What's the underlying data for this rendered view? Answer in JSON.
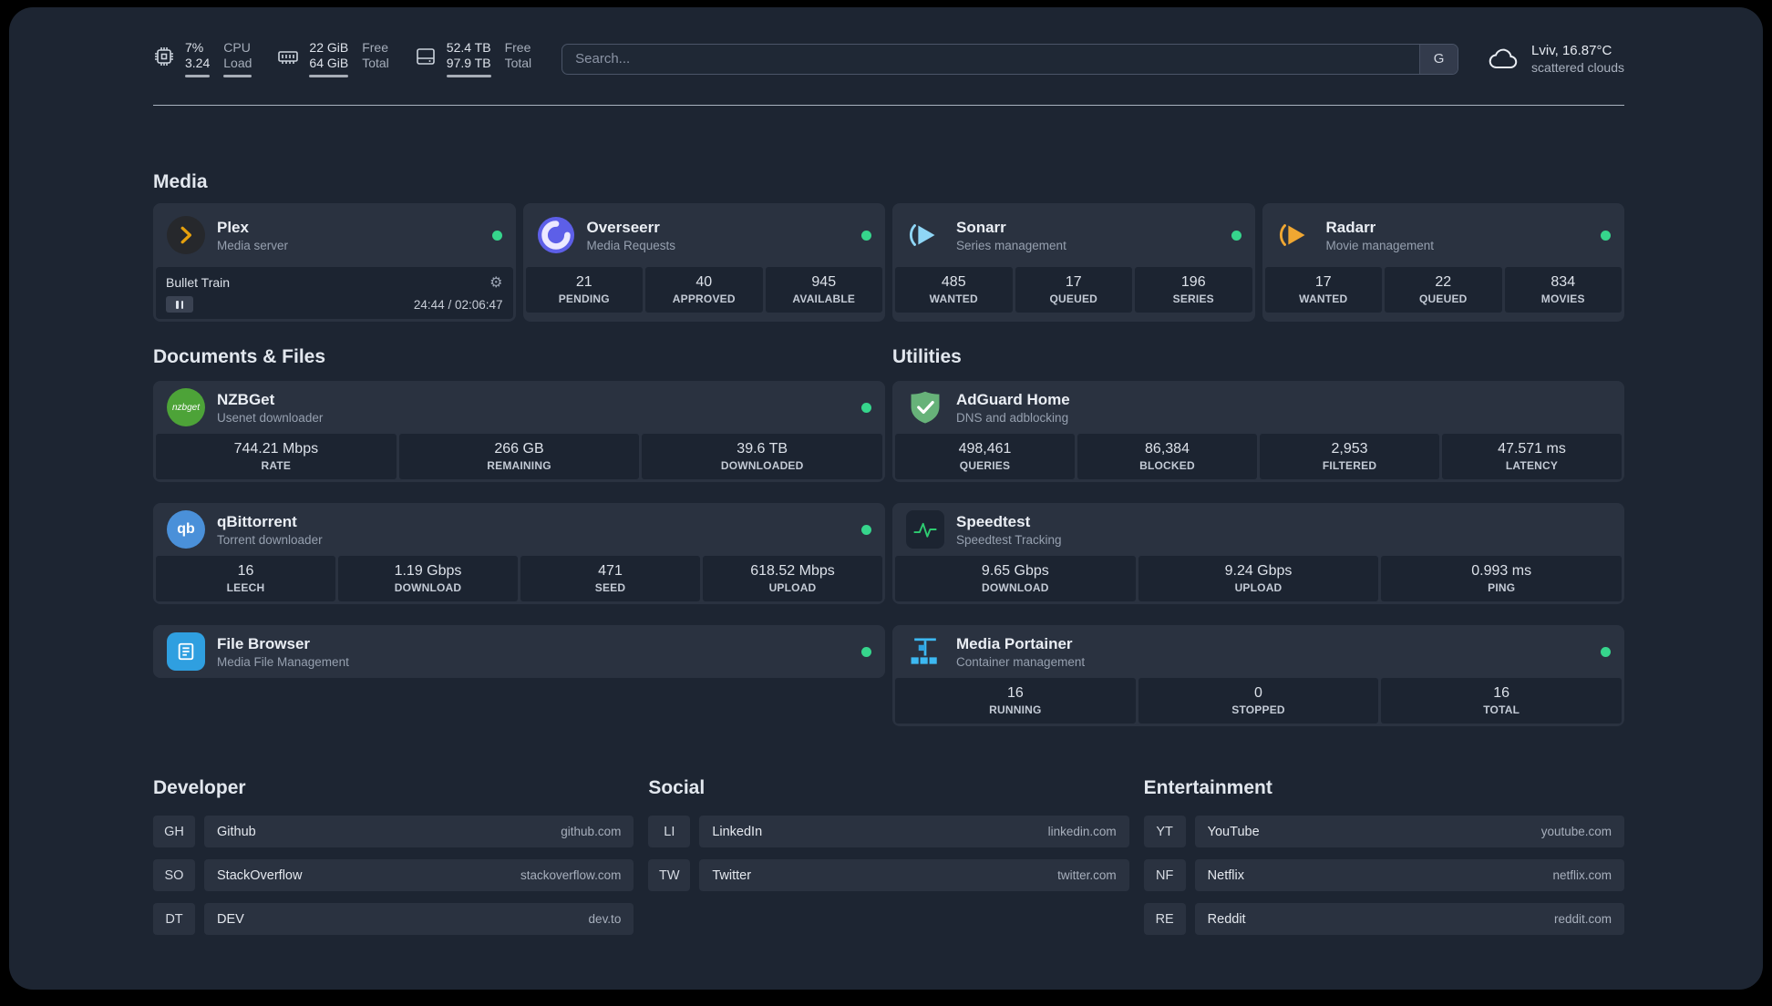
{
  "colors": {
    "status_online": "#36d58c",
    "plex_accent": "#e5a00d",
    "radarr_accent": "#f0a732",
    "sonarr_accent": "#8fd6f6"
  },
  "topbar": {
    "cpu": {
      "value": "7%",
      "load": "3.24",
      "label1": "CPU",
      "label2": "Load"
    },
    "memory": {
      "free": "22 GiB",
      "total": "64 GiB",
      "label1": "Free",
      "label2": "Total"
    },
    "disk": {
      "free": "52.4 TB",
      "total": "97.9 TB",
      "label1": "Free",
      "label2": "Total"
    },
    "search": {
      "placeholder": "Search...",
      "button": "G"
    },
    "weather": {
      "location": "Lviv, 16.87°C",
      "condition": "scattered clouds",
      "icon": "cloud-icon"
    }
  },
  "sections": {
    "media": {
      "title": "Media",
      "cards": {
        "plex": {
          "name": "Plex",
          "subtitle": "Media server",
          "icon": "plex-icon",
          "online": true,
          "player": {
            "track": "Bullet Train",
            "time": "24:44 / 02:06:47"
          }
        },
        "overseerr": {
          "name": "Overseerr",
          "subtitle": "Media Requests",
          "icon": "overseerr-icon",
          "online": true,
          "stats": [
            {
              "value": "21",
              "label": "PENDING"
            },
            {
              "value": "40",
              "label": "APPROVED"
            },
            {
              "value": "945",
              "label": "AVAILABLE"
            }
          ]
        },
        "sonarr": {
          "name": "Sonarr",
          "subtitle": "Series management",
          "icon": "sonarr-icon",
          "online": true,
          "stats": [
            {
              "value": "485",
              "label": "WANTED"
            },
            {
              "value": "17",
              "label": "QUEUED"
            },
            {
              "value": "196",
              "label": "SERIES"
            }
          ]
        },
        "radarr": {
          "name": "Radarr",
          "subtitle": "Movie management",
          "icon": "radarr-icon",
          "online": true,
          "stats": [
            {
              "value": "17",
              "label": "WANTED"
            },
            {
              "value": "22",
              "label": "QUEUED"
            },
            {
              "value": "834",
              "label": "MOVIES"
            }
          ]
        }
      }
    },
    "documents": {
      "title": "Documents & Files",
      "cards": {
        "nzbget": {
          "name": "NZBGet",
          "subtitle": "Usenet downloader",
          "icon": "nzbget-icon",
          "icon_text": "nzbget",
          "online": true,
          "stats": [
            {
              "value": "744.21 Mbps",
              "label": "RATE"
            },
            {
              "value": "266 GB",
              "label": "REMAINING"
            },
            {
              "value": "39.6 TB",
              "label": "DOWNLOADED"
            }
          ]
        },
        "qbittorrent": {
          "name": "qBittorrent",
          "subtitle": "Torrent downloader",
          "icon": "qbittorrent-icon",
          "icon_text": "qb",
          "online": true,
          "stats": [
            {
              "value": "16",
              "label": "LEECH"
            },
            {
              "value": "1.19 Gbps",
              "label": "DOWNLOAD"
            },
            {
              "value": "471",
              "label": "SEED"
            },
            {
              "value": "618.52 Mbps",
              "label": "UPLOAD"
            }
          ]
        },
        "filebrowser": {
          "name": "File Browser",
          "subtitle": "Media File Management",
          "icon": "filebrowser-icon",
          "online": true
        }
      }
    },
    "utilities": {
      "title": "Utilities",
      "cards": {
        "adguard": {
          "name": "AdGuard Home",
          "subtitle": "DNS and adblocking",
          "icon": "adguard-icon",
          "stats": [
            {
              "value": "498,461",
              "label": "QUERIES"
            },
            {
              "value": "86,384",
              "label": "BLOCKED"
            },
            {
              "value": "2,953",
              "label": "FILTERED"
            },
            {
              "value": "47.571 ms",
              "label": "LATENCY"
            }
          ]
        },
        "speedtest": {
          "name": "Speedtest",
          "subtitle": "Speedtest Tracking",
          "icon": "speedtest-icon",
          "stats": [
            {
              "value": "9.65 Gbps",
              "label": "DOWNLOAD"
            },
            {
              "value": "9.24 Gbps",
              "label": "UPLOAD"
            },
            {
              "value": "0.993 ms",
              "label": "PING"
            }
          ]
        },
        "portainer": {
          "name": "Media Portainer",
          "subtitle": "Container management",
          "icon": "portainer-icon",
          "online": true,
          "stats": [
            {
              "value": "16",
              "label": "RUNNING"
            },
            {
              "value": "0",
              "label": "STOPPED"
            },
            {
              "value": "16",
              "label": "TOTAL"
            }
          ]
        }
      }
    }
  },
  "bookmarks": {
    "developer": {
      "title": "Developer",
      "links": [
        {
          "abbr": "GH",
          "name": "Github",
          "url": "github.com"
        },
        {
          "abbr": "SO",
          "name": "StackOverflow",
          "url": "stackoverflow.com"
        },
        {
          "abbr": "DT",
          "name": "DEV",
          "url": "dev.to"
        }
      ]
    },
    "social": {
      "title": "Social",
      "links": [
        {
          "abbr": "LI",
          "name": "LinkedIn",
          "url": "linkedin.com"
        },
        {
          "abbr": "TW",
          "name": "Twitter",
          "url": "twitter.com"
        }
      ]
    },
    "entertainment": {
      "title": "Entertainment",
      "links": [
        {
          "abbr": "YT",
          "name": "YouTube",
          "url": "youtube.com"
        },
        {
          "abbr": "NF",
          "name": "Netflix",
          "url": "netflix.com"
        },
        {
          "abbr": "RE",
          "name": "Reddit",
          "url": "reddit.com"
        }
      ]
    }
  }
}
